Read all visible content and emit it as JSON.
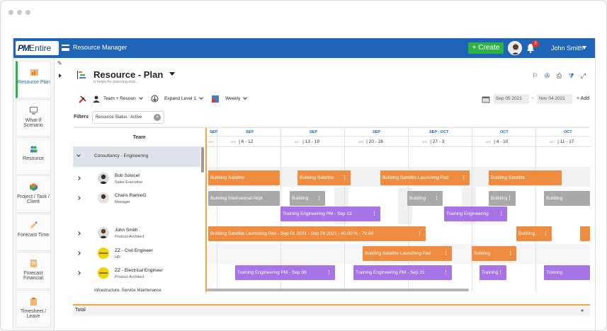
{
  "topbar": {
    "logo_pm": "PM",
    "logo_entire": "Entire",
    "module": "Resource Manager",
    "create_label": "+ Create",
    "notif_count": "2",
    "user_name": "John Smith"
  },
  "sidebar": {
    "items": [
      {
        "label": "Resource Plan"
      },
      {
        "label": "What-If Scenario"
      },
      {
        "label": "Resource"
      },
      {
        "label": "Project / Task / Client"
      },
      {
        "label": "Forecast Time"
      },
      {
        "label": "Forecast Financial"
      },
      {
        "label": "Timesheet / Leave"
      }
    ]
  },
  "page": {
    "title": "Resource - Plan",
    "subtitle": "It helps for planning and..."
  },
  "toolbar": {
    "team_select": "Team + Resoun",
    "expand_select": "Expand Level 1",
    "period_select": "Weekly",
    "date_from": "Sep 05 2021",
    "date_sep": "-",
    "date_to": "Nov 04 2021",
    "add_label": "+ Add"
  },
  "filters": {
    "label": "Filters",
    "chip": "Resource Status : Active",
    "chip_close": "×"
  },
  "grid": {
    "team_header": "Team",
    "group": "Consultancy - Engineering",
    "group2": "Infrastructure, Service Maintenance",
    "rows": [
      {
        "name": "Bob Solocet",
        "role": "Sales Executive"
      },
      {
        "name": "Charis RamieG",
        "role": "Manager"
      },
      {
        "name": "John Smith",
        "role": "Product Architect"
      },
      {
        "name": "ZZ - Civil Engineer",
        "role": "HR"
      },
      {
        "name": "ZZ - Electrical Engineer",
        "role": "Product Architect"
      }
    ]
  },
  "timeline": {
    "months": [
      "SEP",
      "SEP",
      "SEP",
      "SEP",
      "SEP - OCT",
      "OCT",
      "OCT"
    ],
    "weeks": [
      {
        "wn": "W35",
        "range": ""
      },
      {
        "wn": "W36",
        "range": "6 - 12"
      },
      {
        "wn": "W37",
        "range": "13 - 19"
      },
      {
        "wn": "W38",
        "range": "20 - 26"
      },
      {
        "wn": "W39",
        "range": "27 - 3"
      },
      {
        "wn": "W40",
        "range": "4 - 10"
      },
      {
        "wn": "W41",
        "range": "11 - 17"
      }
    ],
    "bars": {
      "b1": "Building Satellite",
      "b2": "Building Satellite",
      "b3": "Building Satellite Launching Pad",
      "b4": "Building Satellite",
      "c1": "Building Internaional Airpt",
      "c2": "Building",
      "c3": "Building",
      "c4": "Building",
      "c5": "Building",
      "p1": "Training Engineering PM - Sep 13",
      "p2": "Training Engineering",
      "j1": "Building Satellite Launching Pad - Sep 01 2021 - Sep 28 2021 - 40.00 % - 76.80",
      "j2": "Building",
      "z1": "Building Satellite Launching Pad",
      "z2": "Building",
      "e1": "Training Engineering PM - Sep 08",
      "e2": "Training Engineering PM - Sep 21",
      "e3": "Training",
      "e4": "Training"
    }
  },
  "footer": {
    "total": "Total",
    "collapse": "»"
  }
}
